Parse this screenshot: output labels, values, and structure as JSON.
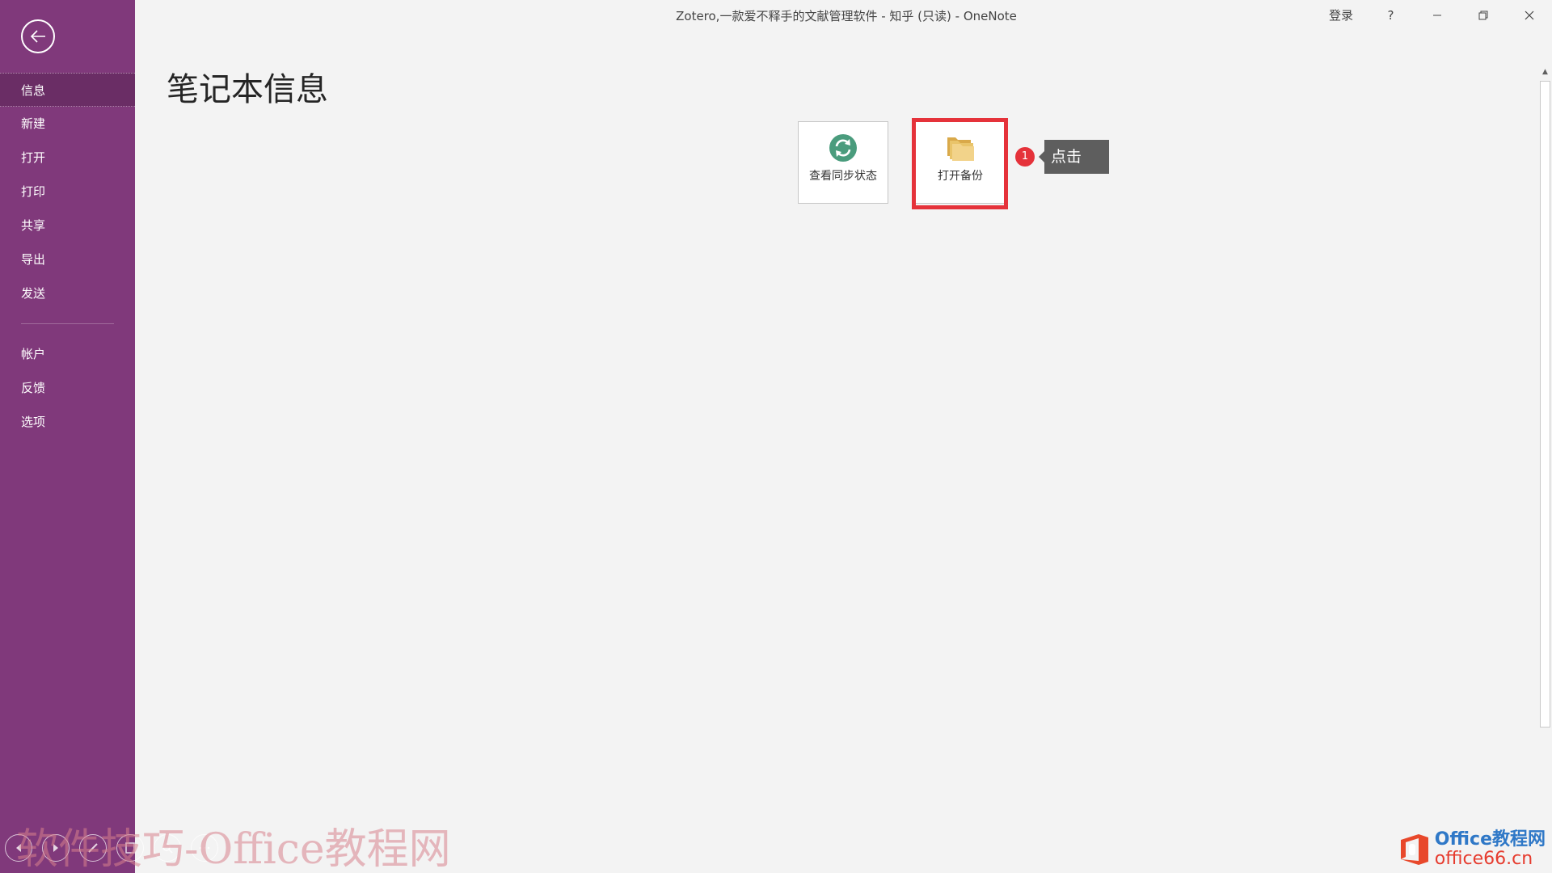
{
  "window": {
    "title": "Zotero,一款爱不释手的文献管理软件 - 知乎 (只读)  -  OneNote",
    "signin_label": "登录",
    "help_label": "?"
  },
  "sidebar": {
    "items": [
      {
        "label": "信息",
        "name": "sidebar-item-info"
      },
      {
        "label": "新建",
        "name": "sidebar-item-new"
      },
      {
        "label": "打开",
        "name": "sidebar-item-open"
      },
      {
        "label": "打印",
        "name": "sidebar-item-print"
      },
      {
        "label": "共享",
        "name": "sidebar-item-share"
      },
      {
        "label": "导出",
        "name": "sidebar-item-export"
      },
      {
        "label": "发送",
        "name": "sidebar-item-send"
      }
    ],
    "items2": [
      {
        "label": "帐户",
        "name": "sidebar-item-account"
      },
      {
        "label": "反馈",
        "name": "sidebar-item-feedback"
      },
      {
        "label": "选项",
        "name": "sidebar-item-options"
      }
    ]
  },
  "main": {
    "title": "笔记本信息",
    "tiles": {
      "sync_label": "查看同步状态",
      "backup_label": "打开备份"
    },
    "annotation": {
      "step": "1",
      "callout": "点击"
    }
  },
  "watermark": {
    "left_text": "软件技巧-Office教程网",
    "brand_top": "Office教程网",
    "brand_bottom": "office66.cn"
  },
  "colors": {
    "sidebar": "#80397b",
    "highlight": "#e5323a",
    "sync_icon": "#4a9c7d",
    "folder_icon": "#e9c46a"
  }
}
